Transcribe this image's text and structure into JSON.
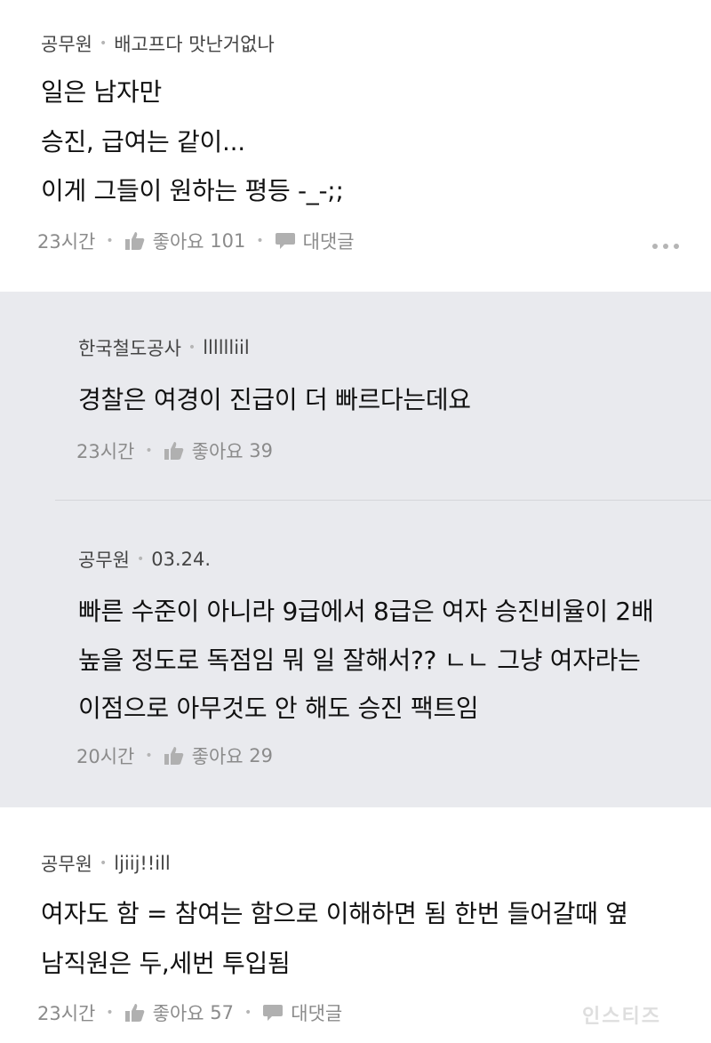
{
  "comments": [
    {
      "nickname": "공무원",
      "author": "배고프다 맛난거없나",
      "lines": [
        "일은 남자만",
        "승진, 급여는 같이...",
        "이게 그들이 원하는 평등 -_-;;"
      ],
      "time": "23시간",
      "like_label": "좋아요",
      "like_count": "101",
      "reply_label": "대댓글"
    },
    {
      "nickname": "공무원",
      "author": "ljiij!!ill",
      "lines": [
        "여자도 함 = 참여는 함으로 이해하면 됨 한번 들어갈때 옆",
        "남직원은 두,세번 투입됨"
      ],
      "time": "23시간",
      "like_label": "좋아요",
      "like_count": "57",
      "reply_label": "대댓글"
    }
  ],
  "replies": [
    {
      "nickname": "한국철도공사",
      "author": "lllllliil",
      "lines": [
        "경찰은 여경이 진급이 더 빠르다는데요"
      ],
      "time": "23시간",
      "like_label": "좋아요",
      "like_count": "39"
    },
    {
      "nickname": "공무원",
      "author": "03.24.",
      "lines": [
        "빠른 수준이 아니라 9급에서 8급은 여자 승진비율이 2배",
        "높을 정도로 독점임 뭐 일 잘해서?? ㄴㄴ 그냥 여자라는",
        "이점으로 아무것도 안 해도 승진 팩트임"
      ],
      "time": "20시간",
      "like_label": "좋아요",
      "like_count": "29"
    }
  ],
  "watermark": "인스티즈",
  "colors": {
    "reply_bg": "#e9eaee",
    "meta_gray": "#8b8b8b",
    "text": "#111111"
  }
}
